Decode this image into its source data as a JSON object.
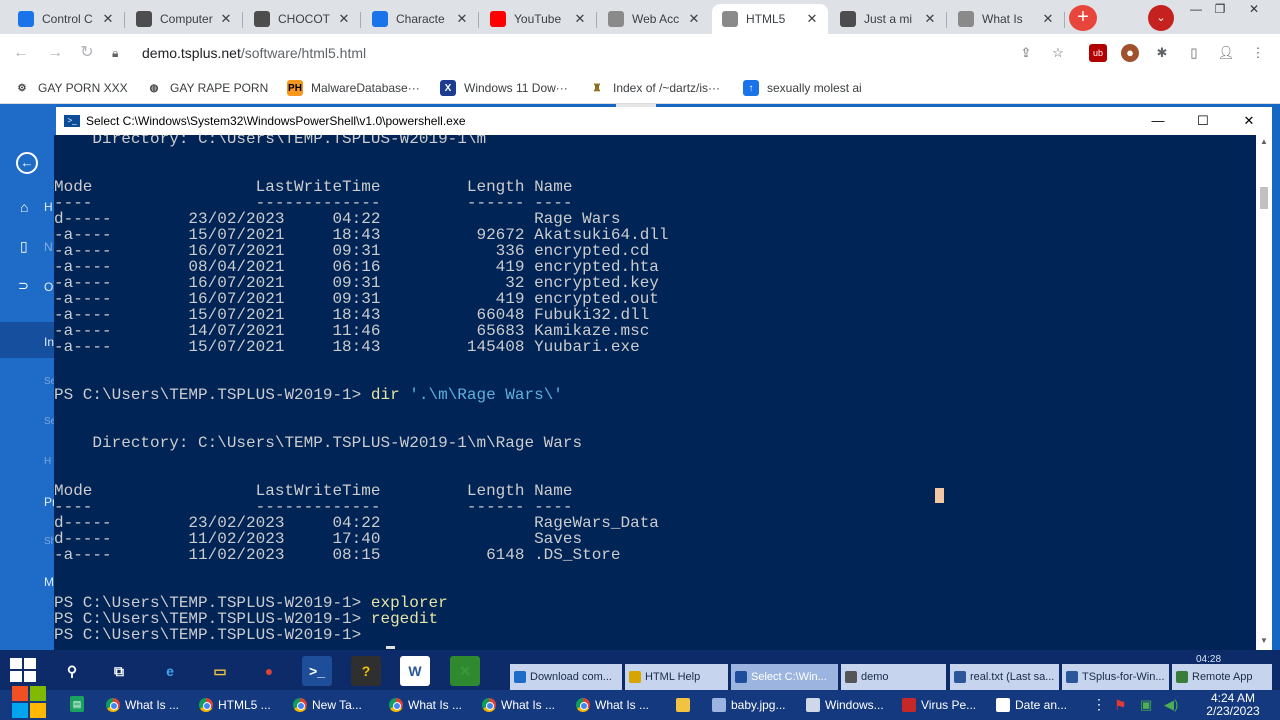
{
  "browser": {
    "tabs": [
      {
        "title": "Control C",
        "icon": "control-panel-icon",
        "color": "#1a73e8"
      },
      {
        "title": "Computer",
        "icon": "computer-icon",
        "color": "#4d4d4d"
      },
      {
        "title": "CHOCOT",
        "icon": "chocolatey-icon",
        "color": "#4d4d4d"
      },
      {
        "title": "Characte",
        "icon": "character-icon",
        "color": "#1a73e8"
      },
      {
        "title": "YouTube",
        "icon": "youtube-icon",
        "color": "#ff0000"
      },
      {
        "title": "Web Acc",
        "icon": "web-icon",
        "color": "#8a8a8a"
      },
      {
        "title": "HTML5",
        "icon": "html5-icon",
        "color": "#8a8a8a"
      },
      {
        "title": "Just a mi",
        "icon": "shield-icon",
        "color": "#4d4d4d"
      },
      {
        "title": "What Is",
        "icon": "web-icon",
        "color": "#8a8a8a"
      }
    ],
    "active_tab": 6,
    "close_glyph": "✕",
    "new_tab_glyph": "+",
    "tab_search_glyph": "⌄",
    "url": "demo.tsplus.net/software/html5.html",
    "url_prefix": "demo.tsplus.net",
    "url_path": "/software/html5.html",
    "bookmarks": [
      {
        "label": "GAY PORN XXX",
        "icon": "gear-icon"
      },
      {
        "label": "GAY RAPE PORN",
        "icon": "globe-icon"
      },
      {
        "label": "MalwareDatabase···",
        "icon": "ph-icon",
        "icon_text": "PH"
      },
      {
        "label": "Windows 11 Dow···",
        "icon": "x-icon",
        "icon_text": "X"
      },
      {
        "label": "Index of /~dartz/is···",
        "icon": "folder-person-icon"
      },
      {
        "label": "sexually molest ai",
        "icon": "blue-app-icon"
      }
    ]
  },
  "remote_panel": {
    "items": [
      "H",
      "N",
      "O",
      "In",
      "Se",
      "Se",
      "H",
      "Pr",
      "Sh",
      "M"
    ]
  },
  "powershell": {
    "title": "Select C:\\Windows\\System32\\WindowsPowerShell\\v1.0\\powershell.exe",
    "lines": [
      "    Directory: C:\\Users\\TEMP.TSPLUS-W2019-1\\m",
      "",
      "",
      "Mode                 LastWriteTime         Length Name",
      "----                 -------------         ------ ----",
      "d-----        23/02/2023     04:22                Rage Wars",
      "-a----        15/07/2021     18:43          92672 Akatsuki64.dll",
      "-a----        16/07/2021     09:31            336 encrypted.cd",
      "-a----        08/04/2021     06:16            419 encrypted.hta",
      "-a----        16/07/2021     09:31             32 encrypted.key",
      "-a----        16/07/2021     09:31            419 encrypted.out",
      "-a----        15/07/2021     18:43          66048 Fubuki32.dll",
      "-a----        14/07/2021     11:46          65683 Kamikaze.msc",
      "-a----        15/07/2021     18:43         145408 Yuubari.exe",
      "",
      "",
      "PS C:\\Users\\TEMP.TSPLUS-W2019-1> ",
      "",
      "",
      "    Directory: C:\\Users\\TEMP.TSPLUS-W2019-1\\m\\Rage Wars",
      "",
      "",
      "Mode                 LastWriteTime         Length Name",
      "----                 -------------         ------ ----",
      "d-----        23/02/2023     04:22                RageWars_Data",
      "d-----        11/02/2023     17:40                Saves",
      "-a----        11/02/2023     08:15           6148 .DS_Store",
      "",
      "",
      "PS C:\\Users\\TEMP.TSPLUS-W2019-1> ",
      "PS C:\\Users\\TEMP.TSPLUS-W2019-1> ",
      "PS C:\\Users\\TEMP.TSPLUS-W2019-1> "
    ],
    "cmd_dir": "dir",
    "cmd_dir_arg": "'.\\m\\Rage Wars\\'",
    "cmd_explorer": "explorer",
    "cmd_regedit": "regedit"
  },
  "taskbar": {
    "pinned": [
      {
        "name": "search-icon",
        "glyph": "⚲"
      },
      {
        "name": "task-view-icon",
        "glyph": "⧉"
      },
      {
        "name": "ie-icon",
        "glyph": "e"
      },
      {
        "name": "file-explorer-icon",
        "glyph": "▭"
      },
      {
        "name": "chrome-icon",
        "glyph": "●"
      },
      {
        "name": "powershell-icon",
        "glyph": ">_"
      },
      {
        "name": "help-icon",
        "glyph": "?"
      },
      {
        "name": "word-icon",
        "glyph": "W"
      },
      {
        "name": "remote-app-icon",
        "glyph": "✕"
      }
    ],
    "tasks": [
      {
        "label": "Download com...",
        "icon": "ie-small-icon",
        "color": "#1e6cc8"
      },
      {
        "label": "HTML Help",
        "icon": "help-small-icon",
        "color": "#d8a400"
      },
      {
        "label": "Select C:\\Win...",
        "icon": "powershell-small-icon",
        "color": "#1e4e9a",
        "selected": true
      },
      {
        "label": "demo",
        "icon": "user-small-icon",
        "color": "#555555"
      },
      {
        "label": "real.txt (Last sa...",
        "icon": "word-small-icon",
        "color": "#2b579a"
      },
      {
        "label": "TSplus-for-Win...",
        "icon": "word-small-icon",
        "color": "#2b579a"
      },
      {
        "label": "Remote App",
        "icon": "remote-small-icon",
        "color": "#3a7d3a"
      }
    ],
    "row2": [
      {
        "label": "What Is ...",
        "icon": "chrome-icon"
      },
      {
        "label": "HTML5 ...",
        "icon": "chrome-icon"
      },
      {
        "label": "New Ta...",
        "icon": "chrome-icon"
      },
      {
        "label": "What Is ...",
        "icon": "chrome-icon"
      },
      {
        "label": "What Is ...",
        "icon": "chrome-icon"
      },
      {
        "label": "What Is ...",
        "icon": "chrome-icon"
      },
      {
        "label": "",
        "icon": "folder-icon"
      },
      {
        "label": "baby.jpg...",
        "icon": "image-icon"
      },
      {
        "label": "Windows...",
        "icon": "window-icon"
      },
      {
        "label": "Virus Pe...",
        "icon": "virus-icon"
      },
      {
        "label": "Date an...",
        "icon": "settings-icon"
      }
    ],
    "remote_time": "04:28",
    "clock_time": "4:24 AM",
    "clock_date": "2/23/2023"
  }
}
